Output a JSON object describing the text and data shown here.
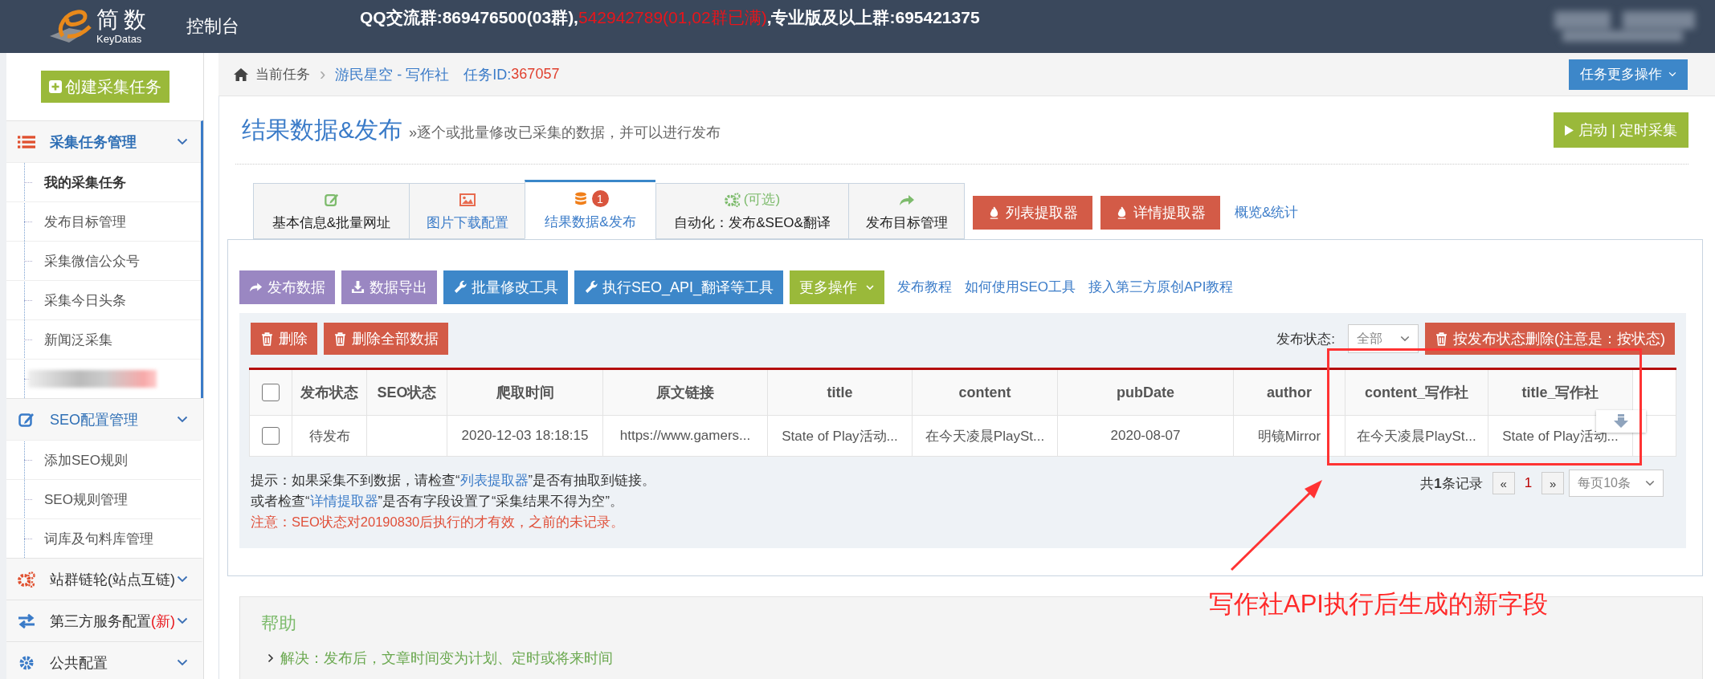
{
  "header": {
    "brand": "简数",
    "brand_sub": "KeyDatas",
    "title": "控制台",
    "notice": [
      {
        "text": "QQ交流群:869476500(03群),",
        "kind": "normal"
      },
      {
        "text": "542942789(01,02群已满)",
        "kind": "warn"
      },
      {
        "text": ",专业版及以上群:695421375",
        "kind": "normal"
      }
    ]
  },
  "sidebar": {
    "create_button": "创建采集任务",
    "groups": [
      {
        "label": "采集任务管理",
        "active": true,
        "expanded": true,
        "children": [
          {
            "kind": "link",
            "label": "我的采集任务",
            "selected": true
          },
          {
            "kind": "link",
            "label": "发布目标管理",
            "selected": false
          },
          {
            "kind": "link",
            "label": "采集微信公众号",
            "selected": false
          },
          {
            "kind": "link",
            "label": "采集今日头条",
            "selected": false
          },
          {
            "kind": "link",
            "label": "新闻泛采集",
            "selected": false
          },
          {
            "kind": "redacted"
          }
        ]
      },
      {
        "label": "SEO配置管理",
        "active": false,
        "expanded": true,
        "children": [
          {
            "kind": "link",
            "label": "添加SEO规则",
            "selected": false
          },
          {
            "kind": "link",
            "label": "SEO规则管理",
            "selected": false
          },
          {
            "kind": "link",
            "label": "词库及句料库管理",
            "selected": false
          }
        ]
      },
      {
        "label": "站群链轮(站点互链)",
        "active": false,
        "expanded": false
      },
      {
        "label": "第三方服务配置",
        "badge": "(新)",
        "active": false,
        "expanded": false
      },
      {
        "label": "公共配置",
        "active": false,
        "expanded": false
      }
    ]
  },
  "breadcrumb": {
    "root": "当前任务",
    "separator": "›",
    "task": "游民星空 - 写作社",
    "id_label": "任务ID:",
    "id": "367057"
  },
  "more_ops_button": "任务更多操作",
  "page_title": "结果数据&发布",
  "page_subtitle": "»逐个或批量修改已采集的数据，并可以进行发布",
  "start_button": "启动 | 定时采集",
  "tabs": [
    {
      "label": "基本信息&批量网址",
      "highlighted": false,
      "selected": false
    },
    {
      "label": "图片下载配置",
      "highlighted": true,
      "selected": false
    },
    {
      "label": "结果数据&发布",
      "badge": "1",
      "highlighted": false,
      "selected": true
    },
    {
      "label": "自动化：发布&SEO&翻译",
      "top": "(可选)",
      "highlighted": false,
      "selected": false
    },
    {
      "label": "发布目标管理",
      "highlighted": false,
      "selected": false
    }
  ],
  "extractor_buttons": [
    "列表提取器",
    "详情提取器"
  ],
  "overview_link": "概览&统计",
  "toolbar": {
    "buttons": [
      {
        "label": "发布数据",
        "kind": "purple"
      },
      {
        "label": "数据导出",
        "kind": "purple"
      },
      {
        "label": "批量修改工具",
        "kind": "blue"
      },
      {
        "label": "执行SEO_API_翻译等工具",
        "kind": "blue"
      },
      {
        "label": "更多操作",
        "kind": "green"
      }
    ],
    "links": [
      "发布教程",
      "如何使用SEO工具",
      "接入第三方原创API教程"
    ]
  },
  "panel": {
    "delete_buttons": [
      "删除",
      "删除全部数据"
    ],
    "status_label": "发布状态:",
    "status_select": "全部",
    "status_delete_button": "按发布状态删除(注意是：按状态)"
  },
  "table": {
    "header_checked": false,
    "columns": [
      "发布状态",
      "SEO状态",
      "爬取时间",
      "原文链接",
      "title",
      "content",
      "pubDate",
      "author",
      "content_写作社",
      "title_写作社"
    ],
    "rows": [
      {
        "checked": false,
        "cells": [
          "待发布",
          "",
          "2020-12-03 18:18:15",
          "https://www.gamers...",
          "State of Play活动...",
          "在今天凌晨PlaySt...",
          "2020-08-07",
          "明镜Mirror",
          "在今天凌晨PlaySt...",
          "State of Play活动..."
        ]
      }
    ]
  },
  "hints": [
    {
      "kind": "normal",
      "parts": [
        {
          "kind": "text",
          "text": "提示：如果采集不到数据，请检查“"
        },
        {
          "kind": "link",
          "text": "列表提取器"
        },
        {
          "kind": "text",
          "text": "”是否有抽取到链接。"
        }
      ]
    },
    {
      "kind": "normal",
      "parts": [
        {
          "kind": "text",
          "text": "或者检查“"
        },
        {
          "kind": "link",
          "text": "详情提取器"
        },
        {
          "kind": "text",
          "text": "”是否有字段设置了“采集结果不得为空”。"
        }
      ]
    },
    {
      "kind": "warn",
      "parts": [
        {
          "kind": "text",
          "text": "注意：SEO状态对20190830后执行的才有效，之前的未记录。"
        }
      ]
    }
  ],
  "pagination": {
    "total": "共**1**条记录",
    "prev": "«",
    "pages": [
      {
        "label": "1",
        "selected": true
      }
    ],
    "next": "»",
    "per_page": "每页10条"
  },
  "help": {
    "title": "帮助",
    "items": [
      "解决：发布后，文章时间变为计划、定时或将来时间"
    ]
  },
  "annotation": {
    "text": "写作社API执行后生成的新字段"
  }
}
